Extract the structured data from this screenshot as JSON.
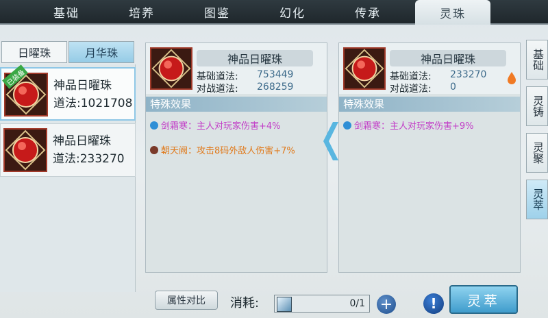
{
  "tabs": [
    "基础",
    "培养",
    "图鉴",
    "幻化",
    "传承",
    "灵珠"
  ],
  "active_tab": "灵珠",
  "subtabs": [
    "日曜珠",
    "月华珠"
  ],
  "left_list": [
    {
      "name": "神品日曜珠",
      "value": "道法:1021708",
      "badge": "已装备"
    },
    {
      "name": "神品日曜珠",
      "value": "道法:233270"
    }
  ],
  "cards": [
    {
      "title": "神品日曜珠",
      "base_label": "基础道法:",
      "base_value": "753449",
      "battle_label": "对战道法:",
      "battle_value": "268259",
      "section": "特殊效果",
      "effects": [
        {
          "text": "剑霜寒：主人对玩家伤害+4%",
          "color": "#c23cc7"
        },
        {
          "text": "朝天阙：攻击8码外敌人伤害+7%",
          "color": "#e07a1c"
        }
      ]
    },
    {
      "title": "神品日曜珠",
      "base_label": "基础道法:",
      "base_value": "233270",
      "battle_label": "对战道法:",
      "battle_value": "0",
      "section": "特殊效果",
      "effects": [
        {
          "text": "剑霜寒：主人对玩家伤害+9%",
          "color": "#c23cc7"
        }
      ]
    }
  ],
  "side_tabs": [
    "基础",
    "灵铸",
    "灵聚",
    "灵萃"
  ],
  "active_side_tab": "灵萃",
  "bottom": {
    "compare_button": "属性对比",
    "cost_label": "消耗:",
    "cost_count": "0/1",
    "plus": "+",
    "info": "!",
    "main_button": "灵萃"
  }
}
